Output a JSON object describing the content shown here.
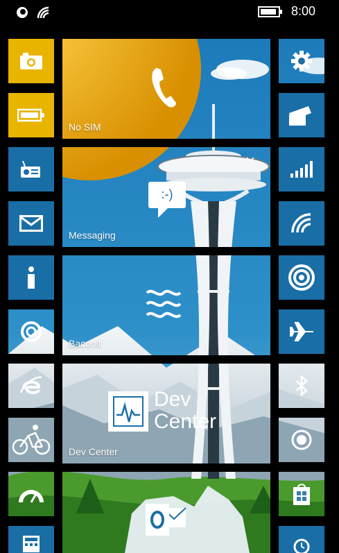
{
  "status": {
    "time": "8:00",
    "battery_level": 0.9
  },
  "tiles": {
    "phone": {
      "label": "No SIM",
      "icon": "phone-icon"
    },
    "messaging": {
      "label": "Messaging",
      "icon": "smiley-bubble-icon",
      "bubble_text": ":-)"
    },
    "baconit": {
      "label": "Baconit",
      "icon": "wave-icon"
    },
    "devcenter": {
      "label": "Dev Center",
      "icon": "dev-center-logo",
      "logo_line1": "Dev",
      "logo_line2": "Center"
    },
    "outlook": {
      "icon": "outlook-icon"
    }
  },
  "left_column_icons": [
    "camera-icon",
    "battery-icon",
    "radio-icon",
    "mail-icon",
    "info-icon",
    "cortana-icon",
    "ie-icon",
    "cycling-icon",
    "speedometer-icon",
    "calculator-icon"
  ],
  "right_column_icons": [
    "gear-icon",
    "project-icon",
    "signal-icon",
    "wifi-icon",
    "target-icon",
    "airplane-icon",
    "bluetooth-icon",
    "record-icon",
    "store-icon",
    "alarm-icon"
  ],
  "colors": {
    "tile_blue": "#1a6ea6",
    "tile_yellow": "#e8b400",
    "background": "#000000"
  }
}
